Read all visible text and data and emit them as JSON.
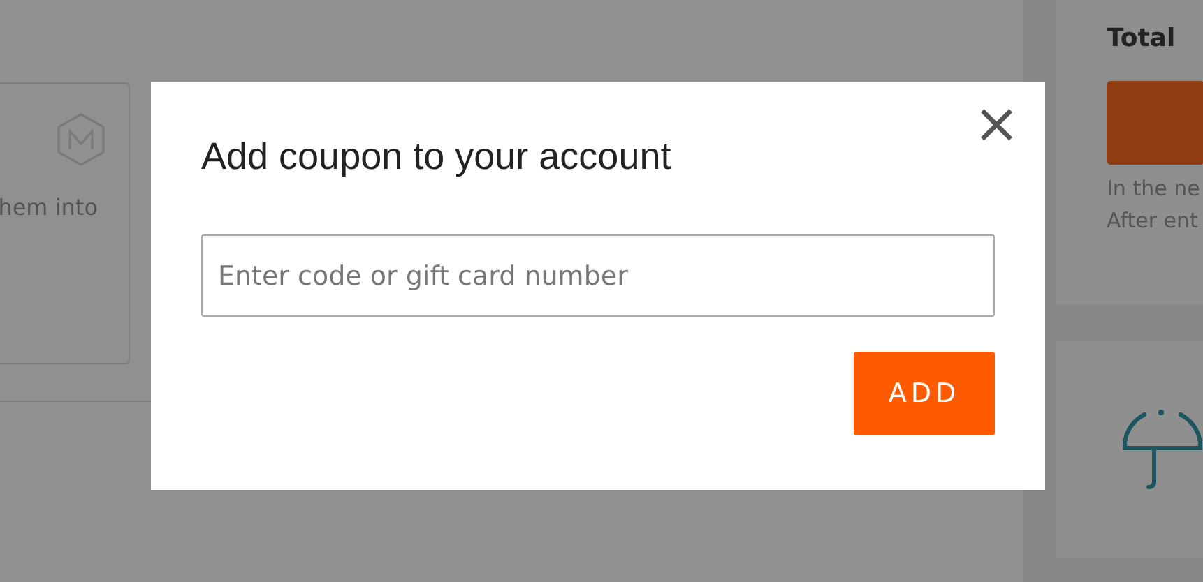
{
  "background": {
    "card_text": "hem into",
    "total_title": "Total",
    "info_lines": [
      "In the ne",
      "After ent"
    ]
  },
  "dialog": {
    "title": "Add coupon to your account",
    "close": "×",
    "field": {
      "placeholder": "Enter code or gift card number"
    },
    "button": "ADD"
  }
}
